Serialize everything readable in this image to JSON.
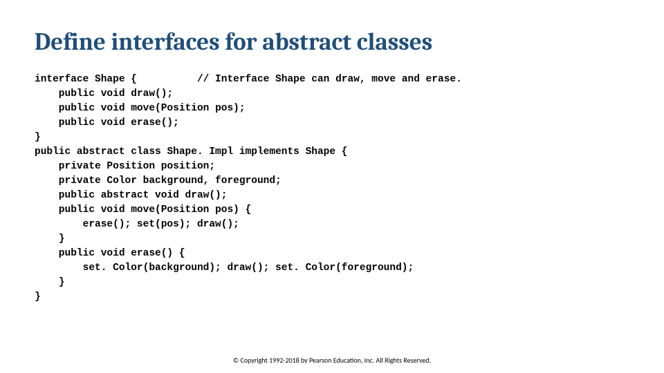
{
  "title": "Define interfaces for abstract classes",
  "code": {
    "l1a": "interface ",
    "l1b": "Shape ",
    "l1c": "{          // Interface Shape can draw, move and erase.",
    "l2": "    public void draw();",
    "l3a": "    public void move(",
    "l3b": "Position ",
    "l3c": "pos);",
    "l4": "    public void erase();",
    "l5": "}",
    "l6a": "public abstract class ",
    "l6b": "Shape. Impl ",
    "l6c": "implements ",
    "l6d": "Shape ",
    "l6e": "{",
    "l7a": "    private ",
    "l7b": "Position ",
    "l7c": "position;",
    "l8a": "    private ",
    "l8b": "Color ",
    "l8c": "background, foreground;",
    "l9": "    public abstract void draw();",
    "l10a": "    public void move(",
    "l10b": "Position ",
    "l10c": "pos) {",
    "l11": "        erase(); set(pos); draw();",
    "l12": "    }",
    "l13": "    public void erase() {",
    "l14": "        set. Color(background); draw(); set. Color(foreground);",
    "l15": "    }",
    "l16": "}"
  },
  "footer": "© Copyright 1992-2018 by Pearson Education, Inc. All Rights Reserved."
}
